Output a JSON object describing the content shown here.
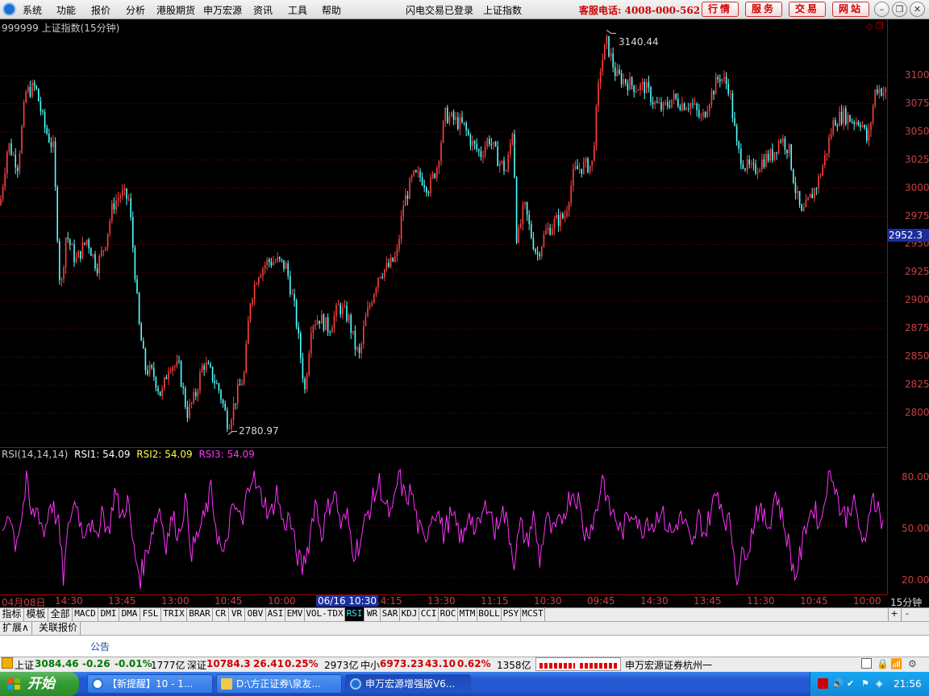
{
  "menubar": {
    "items": [
      "系统",
      "功能",
      "报价",
      "分析",
      "港股期货",
      "申万宏源",
      "资讯",
      "工具",
      "帮助"
    ],
    "status_login": "闪电交易已登录",
    "status_index": "上证指数",
    "hotline": "客服电话: 4008-000-562",
    "buttons": [
      "行情",
      "服务",
      "交易",
      "网站"
    ]
  },
  "chart": {
    "title": "999999 上证指数(15分钟)",
    "price_ticks": [
      "3100",
      "3075",
      "3050",
      "3025",
      "3000",
      "2975",
      "2950",
      "2925",
      "2900",
      "2875",
      "2850",
      "2825",
      "2800"
    ],
    "current_price": "2952.3",
    "high_label": "3140.44",
    "low_label": "2780.97"
  },
  "chart_data": {
    "type": "candlestick",
    "period": "15分钟",
    "ylim": [
      2770,
      3150
    ],
    "high": 3140.44,
    "low": 2780.97,
    "current": 2952.3,
    "close_path": [
      [
        0,
        2985
      ],
      [
        10,
        3040
      ],
      [
        22,
        3020
      ],
      [
        32,
        3085
      ],
      [
        44,
        3090
      ],
      [
        55,
        3055
      ],
      [
        66,
        3035
      ],
      [
        75,
        2905
      ],
      [
        82,
        2960
      ],
      [
        94,
        2935
      ],
      [
        108,
        2955
      ],
      [
        120,
        2930
      ],
      [
        130,
        2950
      ],
      [
        140,
        2985
      ],
      [
        150,
        2995
      ],
      [
        160,
        2990
      ],
      [
        168,
        2920
      ],
      [
        172,
        2880
      ],
      [
        180,
        2840
      ],
      [
        190,
        2835
      ],
      [
        200,
        2815
      ],
      [
        210,
        2845
      ],
      [
        222,
        2840
      ],
      [
        232,
        2800
      ],
      [
        242,
        2815
      ],
      [
        252,
        2845
      ],
      [
        262,
        2835
      ],
      [
        272,
        2820
      ],
      [
        283,
        2790
      ],
      [
        293,
        2815
      ],
      [
        303,
        2835
      ],
      [
        310,
        2900
      ],
      [
        320,
        2925
      ],
      [
        332,
        2935
      ],
      [
        344,
        2935
      ],
      [
        355,
        2930
      ],
      [
        366,
        2890
      ],
      [
        378,
        2820
      ],
      [
        386,
        2880
      ],
      [
        396,
        2885
      ],
      [
        408,
        2875
      ],
      [
        420,
        2895
      ],
      [
        432,
        2885
      ],
      [
        440,
        2860
      ],
      [
        446,
        2850
      ],
      [
        452,
        2880
      ],
      [
        462,
        2905
      ],
      [
        470,
        2925
      ],
      [
        482,
        2930
      ],
      [
        492,
        2940
      ],
      [
        500,
        2985
      ],
      [
        512,
        3010
      ],
      [
        522,
        3010
      ],
      [
        532,
        3000
      ],
      [
        542,
        3020
      ],
      [
        552,
        3065
      ],
      [
        564,
        3060
      ],
      [
        575,
        3055
      ],
      [
        585,
        3040
      ],
      [
        596,
        3030
      ],
      [
        606,
        3045
      ],
      [
        618,
        3025
      ],
      [
        628,
        3015
      ],
      [
        636,
        3055
      ],
      [
        641,
        2950
      ],
      [
        650,
        2985
      ],
      [
        658,
        2960
      ],
      [
        666,
        2940
      ],
      [
        676,
        2960
      ],
      [
        688,
        2970
      ],
      [
        700,
        2975
      ],
      [
        712,
        3015
      ],
      [
        724,
        3020
      ],
      [
        734,
        3020
      ],
      [
        744,
        3105
      ],
      [
        752,
        3130
      ],
      [
        764,
        3100
      ],
      [
        776,
        3095
      ],
      [
        788,
        3090
      ],
      [
        800,
        3090
      ],
      [
        812,
        3075
      ],
      [
        822,
        3070
      ],
      [
        834,
        3080
      ],
      [
        846,
        3075
      ],
      [
        858,
        3075
      ],
      [
        870,
        3060
      ],
      [
        880,
        3080
      ],
      [
        892,
        3100
      ],
      [
        904,
        3090
      ],
      [
        914,
        3035
      ],
      [
        924,
        3020
      ],
      [
        934,
        3015
      ],
      [
        946,
        3025
      ],
      [
        958,
        3030
      ],
      [
        968,
        3045
      ],
      [
        978,
        3035
      ],
      [
        986,
        3000
      ],
      [
        994,
        2975
      ],
      [
        1004,
        2990
      ],
      [
        1014,
        3005
      ],
      [
        1024,
        3030
      ],
      [
        1034,
        3060
      ],
      [
        1046,
        3065
      ],
      [
        1058,
        3060
      ],
      [
        1068,
        3060
      ],
      [
        1076,
        3040
      ],
      [
        1086,
        3090
      ],
      [
        1098,
        3085
      ]
    ]
  },
  "rsi": {
    "label": "RSI(14,14,14)",
    "rsi1": "RSI1: 54.09",
    "rsi2": "RSI2: 54.09",
    "rsi3": "RSI3: 54.09",
    "ticks": [
      "80.00",
      "50.00",
      "20.00"
    ],
    "ylim": [
      10,
      95
    ],
    "path": [
      [
        0,
        45
      ],
      [
        8,
        60
      ],
      [
        16,
        40
      ],
      [
        24,
        55
      ],
      [
        30,
        75
      ],
      [
        36,
        55
      ],
      [
        44,
        60
      ],
      [
        52,
        45
      ],
      [
        60,
        65
      ],
      [
        70,
        50
      ],
      [
        76,
        20
      ],
      [
        84,
        55
      ],
      [
        92,
        65
      ],
      [
        100,
        45
      ],
      [
        108,
        55
      ],
      [
        116,
        40
      ],
      [
        124,
        60
      ],
      [
        132,
        45
      ],
      [
        140,
        70
      ],
      [
        148,
        55
      ],
      [
        156,
        65
      ],
      [
        164,
        35
      ],
      [
        172,
        20
      ],
      [
        180,
        35
      ],
      [
        188,
        50
      ],
      [
        196,
        60
      ],
      [
        204,
        40
      ],
      [
        212,
        55
      ],
      [
        220,
        45
      ],
      [
        228,
        65
      ],
      [
        236,
        35
      ],
      [
        244,
        45
      ],
      [
        252,
        55
      ],
      [
        260,
        70
      ],
      [
        268,
        45
      ],
      [
        276,
        30
      ],
      [
        284,
        55
      ],
      [
        292,
        60
      ],
      [
        300,
        50
      ],
      [
        306,
        75
      ],
      [
        312,
        80
      ],
      [
        318,
        70
      ],
      [
        326,
        65
      ],
      [
        334,
        55
      ],
      [
        342,
        70
      ],
      [
        350,
        50
      ],
      [
        358,
        55
      ],
      [
        366,
        35
      ],
      [
        374,
        25
      ],
      [
        382,
        40
      ],
      [
        390,
        65
      ],
      [
        398,
        45
      ],
      [
        406,
        60
      ],
      [
        414,
        70
      ],
      [
        422,
        50
      ],
      [
        430,
        55
      ],
      [
        438,
        35
      ],
      [
        446,
        40
      ],
      [
        454,
        55
      ],
      [
        462,
        65
      ],
      [
        470,
        75
      ],
      [
        478,
        60
      ],
      [
        486,
        55
      ],
      [
        494,
        80
      ],
      [
        502,
        65
      ],
      [
        510,
        70
      ],
      [
        518,
        50
      ],
      [
        526,
        40
      ],
      [
        534,
        55
      ],
      [
        542,
        60
      ],
      [
        550,
        45
      ],
      [
        558,
        55
      ],
      [
        566,
        50
      ],
      [
        574,
        40
      ],
      [
        582,
        60
      ],
      [
        590,
        45
      ],
      [
        598,
        55
      ],
      [
        606,
        65
      ],
      [
        614,
        45
      ],
      [
        622,
        60
      ],
      [
        630,
        50
      ],
      [
        638,
        30
      ],
      [
        646,
        50
      ],
      [
        654,
        40
      ],
      [
        662,
        55
      ],
      [
        670,
        30
      ],
      [
        678,
        55
      ],
      [
        686,
        45
      ],
      [
        694,
        50
      ],
      [
        702,
        60
      ],
      [
        710,
        70
      ],
      [
        718,
        65
      ],
      [
        726,
        45
      ],
      [
        734,
        50
      ],
      [
        742,
        60
      ],
      [
        748,
        80
      ],
      [
        756,
        60
      ],
      [
        764,
        55
      ],
      [
        772,
        45
      ],
      [
        780,
        55
      ],
      [
        788,
        60
      ],
      [
        796,
        45
      ],
      [
        804,
        55
      ],
      [
        812,
        50
      ],
      [
        820,
        60
      ],
      [
        828,
        50
      ],
      [
        836,
        45
      ],
      [
        844,
        55
      ],
      [
        852,
        50
      ],
      [
        860,
        35
      ],
      [
        868,
        55
      ],
      [
        876,
        45
      ],
      [
        884,
        60
      ],
      [
        892,
        70
      ],
      [
        900,
        55
      ],
      [
        908,
        50
      ],
      [
        916,
        20
      ],
      [
        924,
        35
      ],
      [
        932,
        40
      ],
      [
        940,
        60
      ],
      [
        948,
        55
      ],
      [
        956,
        50
      ],
      [
        964,
        70
      ],
      [
        972,
        55
      ],
      [
        980,
        40
      ],
      [
        988,
        20
      ],
      [
        996,
        35
      ],
      [
        1004,
        55
      ],
      [
        1012,
        60
      ],
      [
        1020,
        50
      ],
      [
        1028,
        75
      ],
      [
        1036,
        80
      ],
      [
        1044,
        60
      ],
      [
        1052,
        55
      ],
      [
        1060,
        65
      ],
      [
        1068,
        50
      ],
      [
        1076,
        35
      ],
      [
        1084,
        70
      ],
      [
        1092,
        60
      ],
      [
        1098,
        50
      ]
    ]
  },
  "time_axis": {
    "ticks": [
      [
        "04月08日",
        2
      ],
      [
        "14:30",
        68
      ],
      [
        "13:45",
        134
      ],
      [
        "13:00",
        200
      ],
      [
        "10:45",
        266
      ],
      [
        "10:00",
        332
      ],
      [
        "14:15",
        464
      ],
      [
        "13:30",
        530
      ],
      [
        "11:15",
        596
      ],
      [
        "10:30",
        662
      ],
      [
        "09:45",
        728
      ],
      [
        "14:30",
        794
      ],
      [
        "13:45",
        860
      ],
      [
        "11:30",
        926
      ],
      [
        "10:45",
        992
      ],
      [
        "10:00",
        1058
      ]
    ],
    "cursor": "06/16 10:30",
    "period": "15分钟"
  },
  "indicator_tabs": [
    "指标",
    "模板",
    "全部",
    "MACD",
    "DMI",
    "DMA",
    "FSL",
    "TRIX",
    "BRAR",
    "CR",
    "VR",
    "OBV",
    "ASI",
    "EMV",
    "VOL-TDX",
    "RSI",
    "WR",
    "SAR",
    "KDJ",
    "CCI",
    "ROC",
    "MTM",
    "BOLL",
    "PSY",
    "MCST"
  ],
  "active_indicator": "RSI",
  "nav": {
    "plus": "+",
    "minus": "-"
  },
  "ext_tabs": [
    "扩展∧",
    "关联报价"
  ],
  "notice": "公告",
  "statusbar": {
    "sh_name": "上证",
    "sh_value": "3084.46",
    "sh_change": "-0.26",
    "sh_pct": "-0.01%",
    "sh_amount": "1777亿",
    "sz_name": "深证",
    "sz_value": "10784.3",
    "sz_change": "26.41",
    "sz_pct": "0.25%",
    "sz_amount": "2973亿",
    "zx_name": "中小",
    "zx_value": "6973.23",
    "zx_change": "43.10",
    "zx_pct": "0.62%",
    "zx_amount": "1358亿",
    "broker": "申万宏源证券杭州一"
  },
  "taskbar": {
    "start": "开始",
    "tasks": [
      "【新提醒】10 - 1...",
      "D:\\方正证券\\泉友...",
      "申万宏源增强版V6..."
    ],
    "clock": "21:56"
  },
  "colors": {
    "up": "#ff4040",
    "down": "#54ffff",
    "rsi": "#ff33ff",
    "grid": "#8a0000"
  }
}
